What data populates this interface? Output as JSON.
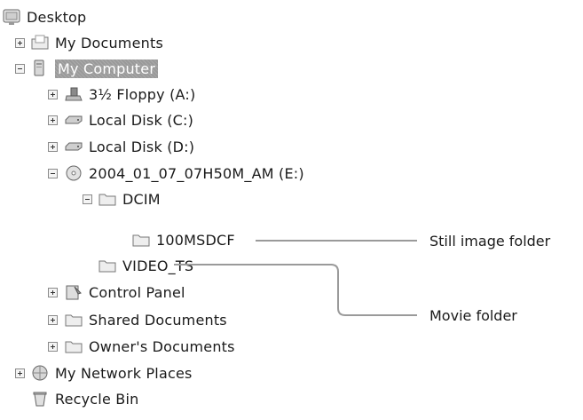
{
  "tree": {
    "desktop": "Desktop",
    "my_documents": "My Documents",
    "my_computer": "My Computer",
    "floppy": "3½ Floppy (A:)",
    "local_c": "Local Disk (C:)",
    "local_d": "Local Disk (D:)",
    "cd_drive": "2004_01_07_07H50M_AM (E:)",
    "dcim": "DCIM",
    "folder_100msdcf": "100MSDCF",
    "video_ts": "VIDEO_TS",
    "control_panel": "Control Panel",
    "shared_documents": "Shared Documents",
    "owners_documents": "Owner's Documents",
    "network_places": "My Network Places",
    "recycle_bin": "Recycle Bin"
  },
  "callouts": {
    "still_image_folder": "Still image folder",
    "movie_folder": "Movie folder"
  }
}
